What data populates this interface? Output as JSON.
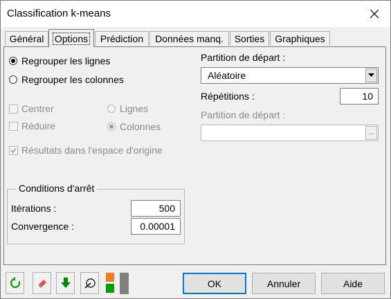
{
  "window": {
    "title": "Classification k-means"
  },
  "tabs": [
    {
      "label": "Général"
    },
    {
      "label": "Options"
    },
    {
      "label": "Prédiction"
    },
    {
      "label": "Données manq."
    },
    {
      "label": "Sorties"
    },
    {
      "label": "Graphiques"
    }
  ],
  "options": {
    "group_rows": "Regrouper les lignes",
    "group_cols": "Regrouper les colonnes",
    "center": "Centrer",
    "reduce": "Réduire",
    "lines": "Lignes",
    "columns": "Colonnes",
    "original_space": "Résultats dans l'espace d'origine",
    "partition_label": "Partition de départ :",
    "partition_value": "Aléatoire",
    "repetitions_label": "Répétitions :",
    "repetitions_value": "10",
    "partition2_label": "Partition de départ :",
    "partition2_value": "",
    "partition2_button": "..."
  },
  "stop_conditions": {
    "title": "Conditions d'arrêt",
    "iterations_label": "Itérations :",
    "iterations_value": "500",
    "convergence_label": "Convergence :",
    "convergence_value": "0.00001"
  },
  "buttons": {
    "ok": "OK",
    "cancel": "Annuler",
    "help": "Aide"
  },
  "colors": {
    "accent": "#0078d7",
    "green": "#00a000",
    "orange": "#f47a20",
    "gray": "#808080"
  }
}
